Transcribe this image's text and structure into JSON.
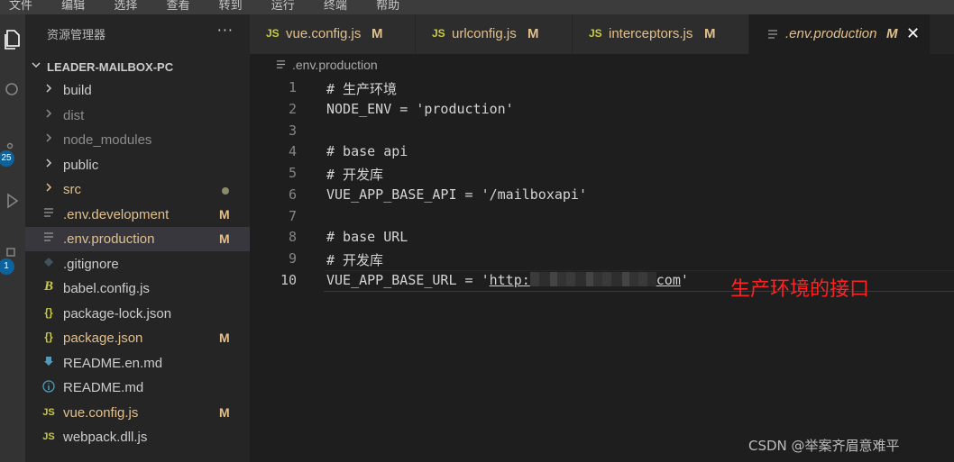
{
  "menu": [
    "文件",
    "编辑",
    "选择",
    "查看",
    "转到",
    "运行",
    "终端",
    "帮助"
  ],
  "activity": {
    "badge_scm": "25",
    "badge_ext": "1"
  },
  "sidebar": {
    "title": "资源管理器",
    "more": "···",
    "project": "LEADER-MAILBOX-PC",
    "items": [
      {
        "label": "build",
        "icon": "chevron-right-icon",
        "status": ""
      },
      {
        "label": "dist",
        "icon": "chevron-right-icon",
        "status": ""
      },
      {
        "label": "node_modules",
        "icon": "chevron-right-icon",
        "status": ""
      },
      {
        "label": "public",
        "icon": "chevron-right-icon",
        "status": ""
      },
      {
        "label": "src",
        "icon": "chevron-right-icon",
        "status": ""
      },
      {
        "label": ".env.development",
        "icon": "file-lines-icon",
        "status": "M"
      },
      {
        "label": ".env.production",
        "icon": "file-lines-icon",
        "status": "M"
      },
      {
        "label": ".gitignore",
        "icon": "git-icon",
        "status": ""
      },
      {
        "label": "babel.config.js",
        "icon": "babel-icon",
        "status": ""
      },
      {
        "label": "package-lock.json",
        "icon": "json-icon",
        "status": ""
      },
      {
        "label": "package.json",
        "icon": "json-icon",
        "status": "M"
      },
      {
        "label": "README.en.md",
        "icon": "download-arrow-icon",
        "status": ""
      },
      {
        "label": "README.md",
        "icon": "info-icon",
        "status": ""
      },
      {
        "label": "vue.config.js",
        "icon": "js-icon",
        "status": "M"
      },
      {
        "label": "webpack.dll.js",
        "icon": "js-icon",
        "status": ""
      }
    ]
  },
  "tabs": [
    {
      "label": "vue.config.js",
      "icon": "JS",
      "status": "M"
    },
    {
      "label": "urlconfig.js",
      "icon": "JS",
      "status": "M"
    },
    {
      "label": "interceptors.js",
      "icon": "JS",
      "status": "M"
    },
    {
      "label": ".env.production",
      "icon": "file-lines-icon",
      "status": "M",
      "close": "✕"
    }
  ],
  "breadcrumb": ".env.production",
  "editor": {
    "lines": [
      {
        "n": "1",
        "text": "# 生产环境"
      },
      {
        "n": "2",
        "text": "NODE_ENV = 'production'"
      },
      {
        "n": "3",
        "text": ""
      },
      {
        "n": "4",
        "text": "# base api"
      },
      {
        "n": "5",
        "text": "# 开发库"
      },
      {
        "n": "6",
        "text": "VUE_APP_BASE_API = '/mailboxapi'"
      },
      {
        "n": "7",
        "text": ""
      },
      {
        "n": "8",
        "text": "# base URL"
      },
      {
        "n": "9",
        "text": "# 开发库"
      },
      {
        "n": "10",
        "pre": "VUE_APP_BASE_URL = '",
        "link_a": "http:",
        "link_b": "com",
        "post": "'"
      }
    ]
  },
  "annotation": "生产环境的接口",
  "watermark": "CSDN @举案齐眉意难平",
  "colors": {
    "modified": "#e2c08d",
    "ignored": "#8c8c8c",
    "js_yellow": "#cbcb41",
    "json_yellow": "#cbcb41",
    "info_blue": "#519aba",
    "annotation_red": "#ff2222"
  }
}
